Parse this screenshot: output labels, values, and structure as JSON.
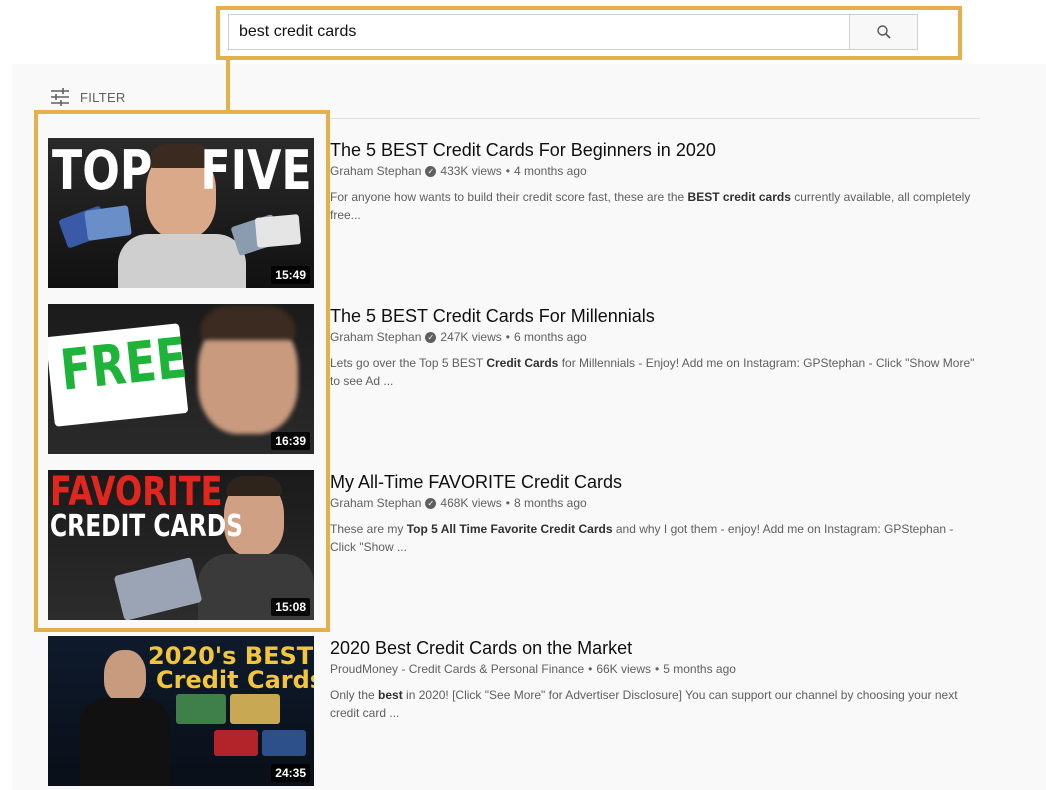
{
  "search": {
    "query": "best credit cards",
    "icon": "search-icon"
  },
  "filter": {
    "label": "FILTER",
    "icon": "filter-sliders-icon"
  },
  "results": [
    {
      "thumb_text": [
        "TOP",
        "FIVE"
      ],
      "duration": "15:49",
      "title": "The 5 BEST Credit Cards For Beginners in 2020",
      "channel": "Graham Stephan",
      "verified": true,
      "views": "433K views",
      "age": "4 months ago",
      "desc_pre": "For anyone how wants to build their credit score fast, these are the ",
      "desc_bold": "BEST credit cards",
      "desc_post": " currently available, all completely free..."
    },
    {
      "thumb_text": [
        "FREE"
      ],
      "duration": "16:39",
      "title": "The 5 BEST Credit Cards For Millennials",
      "channel": "Graham Stephan",
      "verified": true,
      "views": "247K views",
      "age": "6 months ago",
      "desc_pre": "Lets go over the Top 5 BEST ",
      "desc_bold": "Credit Cards",
      "desc_post": " for Millennials - Enjoy! Add me on Instagram: GPStephan - Click \"Show More\" to see Ad ..."
    },
    {
      "thumb_text": [
        "FAVORITE",
        "CREDIT CARDS"
      ],
      "duration": "15:08",
      "title": "My All-Time FAVORITE Credit Cards",
      "channel": "Graham Stephan",
      "verified": true,
      "views": "468K views",
      "age": "8 months ago",
      "desc_pre": "These are my ",
      "desc_bold": "Top 5 All Time Favorite Credit Cards",
      "desc_post": " and why I got them - enjoy! Add me on Instagram: GPStephan - Click \"Show ..."
    },
    {
      "thumb_text": [
        "2020's BEST",
        "Credit Cards"
      ],
      "duration": "24:35",
      "title": "2020 Best Credit Cards on the Market",
      "channel": "ProudMoney - Credit Cards & Personal Finance",
      "verified": false,
      "views": "66K views",
      "age": "5 months ago",
      "desc_pre": "Only the ",
      "desc_bold": "best",
      "desc_post": " in 2020! [Click \"See More\" for Advertiser Disclosure] You can support our channel by choosing your next credit card ..."
    }
  ],
  "colors": {
    "highlight": "#e3b04b",
    "panel_bg": "#f9f9f9",
    "meta_text": "#606060"
  }
}
